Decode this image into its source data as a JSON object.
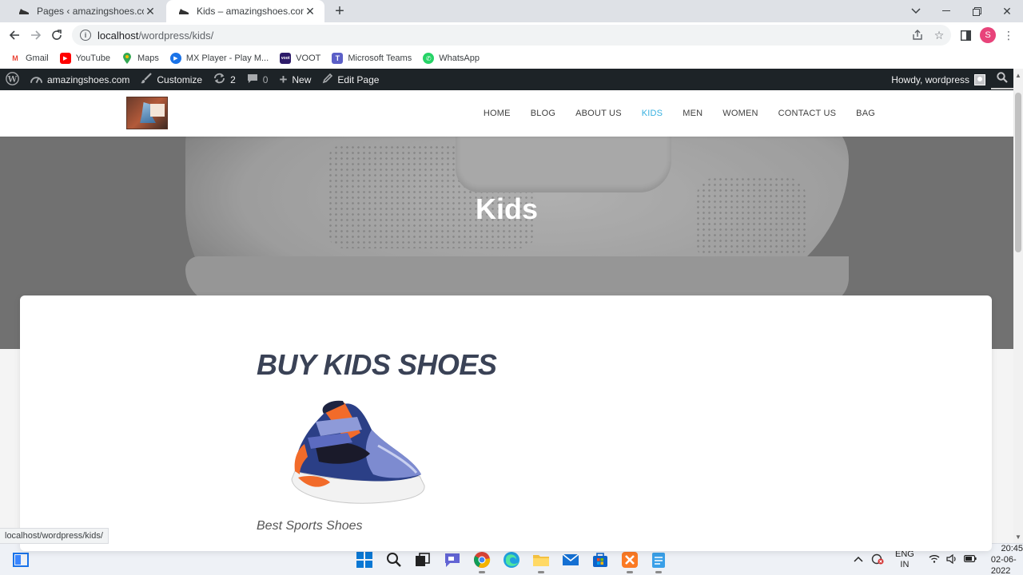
{
  "browser": {
    "tabs": [
      {
        "title": "Pages ‹ amazingshoes.com — W",
        "active": false
      },
      {
        "title": "Kids – amazingshoes.com",
        "active": true
      }
    ],
    "url_host": "localhost",
    "url_path": "/wordpress/kids/",
    "profile_initial": "S",
    "status_url": "localhost/wordpress/kids/"
  },
  "bookmarks": [
    {
      "label": "Gmail",
      "icon": "gmail-icon",
      "color": "#ea4335"
    },
    {
      "label": "YouTube",
      "icon": "youtube-icon",
      "color": "#ff0000"
    },
    {
      "label": "Maps",
      "icon": "maps-icon",
      "color": "#34a853"
    },
    {
      "label": "MX Player - Play M...",
      "icon": "mx-player-icon",
      "color": "#1a73e8"
    },
    {
      "label": "VOOT",
      "icon": "voot-icon",
      "color": "#2d1b69"
    },
    {
      "label": "Microsoft Teams",
      "icon": "teams-icon",
      "color": "#5b5fc7"
    },
    {
      "label": "WhatsApp",
      "icon": "whatsapp-icon",
      "color": "#25d366"
    }
  ],
  "adminbar": {
    "site_name": "amazingshoes.com",
    "customize": "Customize",
    "updates_count": "2",
    "comments_count": "0",
    "new_label": "New",
    "edit_label": "Edit Page",
    "howdy": "Howdy, wordpress"
  },
  "nav": {
    "items": [
      "HOME",
      "BLOG",
      "ABOUT US",
      "KIDS",
      "MEN",
      "WOMEN",
      "CONTACT US",
      "BAG"
    ],
    "active": "KIDS",
    "active_color": "#37b0e0"
  },
  "hero": {
    "title": "Kids"
  },
  "content": {
    "heading": "BUY KIDS SHOES",
    "caption": "Best Sports Shoes"
  },
  "taskbar": {
    "lang_top": "ENG",
    "lang_bottom": "IN",
    "time": "20:45",
    "date": "02-06-2022"
  }
}
